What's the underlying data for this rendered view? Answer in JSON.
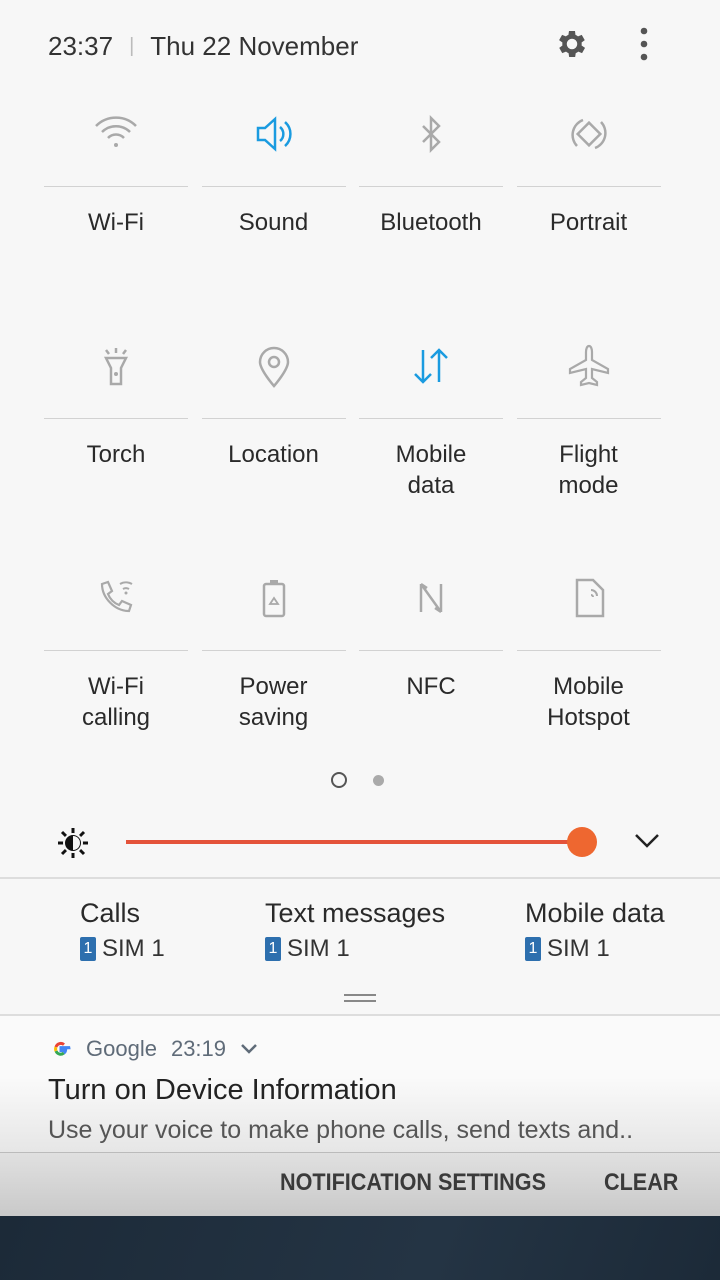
{
  "header": {
    "time": "23:37",
    "separator": "|",
    "date": "Thu 22 November"
  },
  "accent": "#1a9be0",
  "tiles": [
    {
      "label": "Wi-Fi",
      "icon": "wifi-icon",
      "active": false
    },
    {
      "label": "Sound",
      "icon": "sound-icon",
      "active": true
    },
    {
      "label": "Bluetooth",
      "icon": "bluetooth-icon",
      "active": false
    },
    {
      "label": "Portrait",
      "icon": "rotate-icon",
      "active": false
    },
    {
      "label": "Torch",
      "icon": "torch-icon",
      "active": false
    },
    {
      "label": "Location",
      "icon": "location-icon",
      "active": false
    },
    {
      "label": "Mobile\ndata",
      "icon": "mobile-data-icon",
      "active": true
    },
    {
      "label": "Flight\nmode",
      "icon": "airplane-icon",
      "active": false
    },
    {
      "label": "Wi-Fi\ncalling",
      "icon": "wifi-calling-icon",
      "active": false
    },
    {
      "label": "Power\nsaving",
      "icon": "power-saving-icon",
      "active": false
    },
    {
      "label": "NFC",
      "icon": "nfc-icon",
      "active": false
    },
    {
      "label": "Mobile\nHotspot",
      "icon": "hotspot-icon",
      "active": false
    }
  ],
  "pager": {
    "current": 1,
    "total": 2
  },
  "brightness": {
    "level": 1.0,
    "color": "#e4533a"
  },
  "sim": [
    {
      "title": "Calls",
      "badge": "1",
      "sim": "SIM 1"
    },
    {
      "title": "Text messages",
      "badge": "1",
      "sim": "SIM 1"
    },
    {
      "title": "Mobile data",
      "badge": "1",
      "sim": "SIM 1"
    }
  ],
  "notification": {
    "app": "Google",
    "time": "23:19",
    "title": "Turn on Device Information",
    "body": "Use your voice to make phone calls, send texts and.."
  },
  "actions": {
    "settings": "NOTIFICATION SETTINGS",
    "clear": "CLEAR"
  }
}
